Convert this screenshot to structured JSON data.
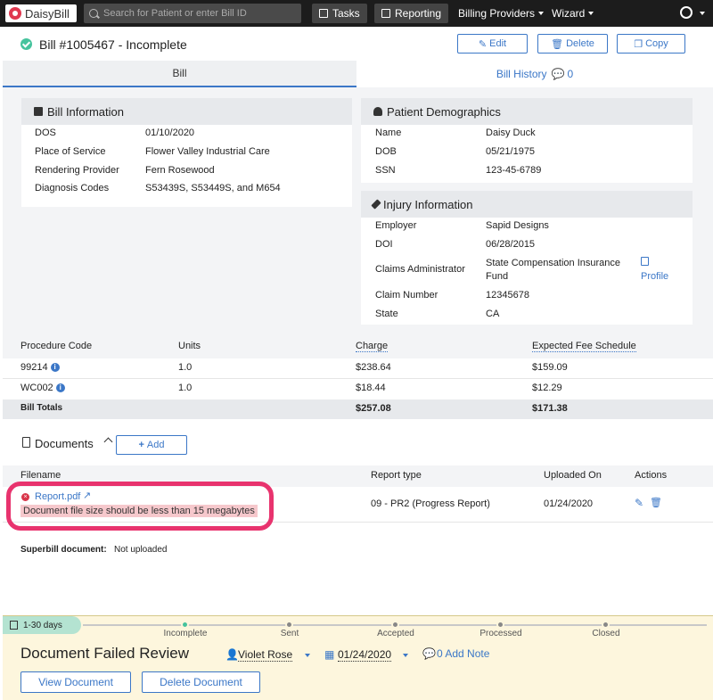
{
  "topbar": {
    "logo": "DaisyBill",
    "search_placeholder": "Search for Patient or enter Bill ID",
    "tasks": "Tasks",
    "reporting": "Reporting",
    "billing_providers": "Billing Providers",
    "wizard": "Wizard"
  },
  "header": {
    "title": "Bill #1005467 - Incomplete",
    "edit": "Edit",
    "delete": "Delete",
    "copy": "Copy"
  },
  "tabs": {
    "bill": "Bill",
    "history": "Bill History",
    "history_count": "0"
  },
  "bill_info": {
    "title": "Bill Information",
    "rows": [
      {
        "label": "DOS",
        "value": "01/10/2020"
      },
      {
        "label": "Place of Service",
        "value": "Flower Valley Industrial Care"
      },
      {
        "label": "Rendering Provider",
        "value": "Fern Rosewood"
      },
      {
        "label": "Diagnosis Codes",
        "value": "S53439S, S53449S, and M654"
      }
    ]
  },
  "patient": {
    "title": "Patient Demographics",
    "rows": [
      {
        "label": "Name",
        "value": "Daisy Duck"
      },
      {
        "label": "DOB",
        "value": "05/21/1975"
      },
      {
        "label": "SSN",
        "value": "123-45-6789"
      }
    ]
  },
  "injury": {
    "title": "Injury Information",
    "employer_label": "Employer",
    "employer": "Sapid Designs",
    "doi_label": "DOI",
    "doi": "06/28/2015",
    "claims_label": "Claims Administrator",
    "claims_line1": "State Compensation Insurance",
    "claims_line2": "Fund",
    "profile": "Profile",
    "claim_label": "Claim Number",
    "claim": "12345678",
    "state_label": "State",
    "state": "CA"
  },
  "procedures": {
    "headers": [
      "Procedure Code",
      "Units",
      "Charge",
      "Expected Fee Schedule"
    ],
    "rows": [
      {
        "code": "99214",
        "units": "1.0",
        "charge": "$238.64",
        "expected": "$159.09"
      },
      {
        "code": "WC002",
        "units": "1.0",
        "charge": "$18.44",
        "expected": "$12.29"
      }
    ],
    "totals_label": "Bill Totals",
    "total_charge": "$257.08",
    "total_expected": "$171.38"
  },
  "documents": {
    "title": "Documents",
    "add": "Add",
    "headers": [
      "Filename",
      "Report type",
      "Uploaded On",
      "Actions"
    ],
    "file": "Report.pdf",
    "error": "Document file size should be less than 15 megabytes",
    "report_type": "09 - PR2 (Progress Report)",
    "uploaded": "01/24/2020",
    "superbill_label": "Superbill document:",
    "superbill_value": "Not uploaded"
  },
  "footer": {
    "badge": "1-30 days",
    "stages": [
      "Incomplete",
      "Sent",
      "Accepted",
      "Processed",
      "Closed"
    ],
    "status": "Document Failed Review",
    "assignee": "Violet Rose",
    "date": "01/24/2020",
    "notes": "0 Add Note",
    "view": "View Document",
    "delete": "Delete Document"
  },
  "colors": {
    "accent": "#3b77c7",
    "highlight": "#e8336e",
    "footer_bg": "#fdf6dd"
  }
}
